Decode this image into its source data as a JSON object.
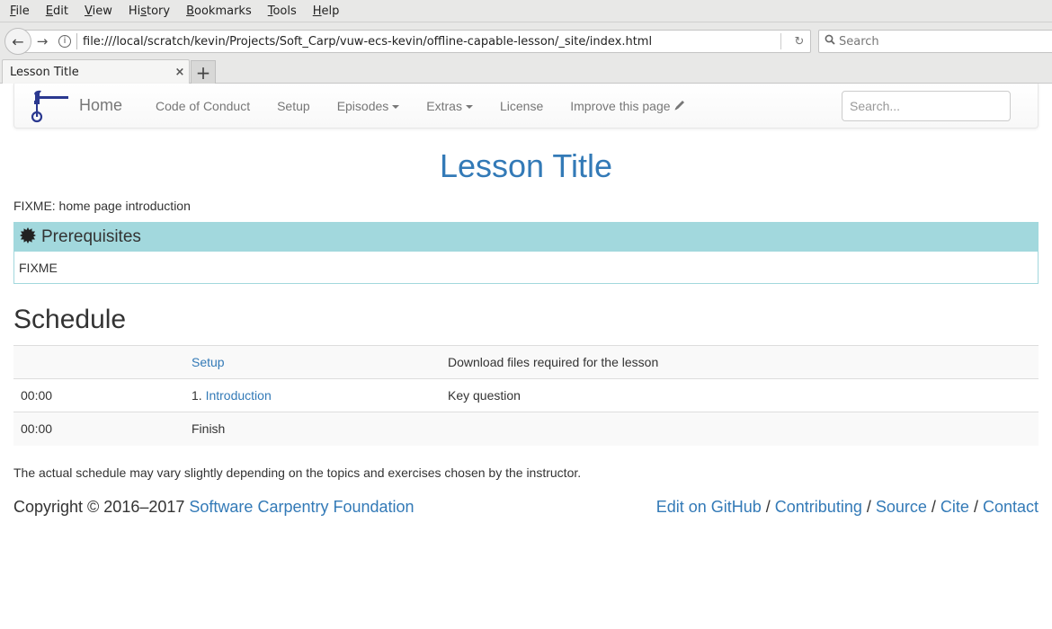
{
  "browser": {
    "menu": [
      {
        "label": "File",
        "accel": "F",
        "rest": "ile",
        "pre": ""
      },
      {
        "label": "Edit",
        "accel": "E",
        "rest": "dit",
        "pre": ""
      },
      {
        "label": "View",
        "accel": "V",
        "rest": "iew",
        "pre": ""
      },
      {
        "label": "History",
        "pre": "Hi",
        "accel": "s",
        "rest": "tory"
      },
      {
        "label": "Bookmarks",
        "accel": "B",
        "rest": "ookmarks",
        "pre": ""
      },
      {
        "label": "Tools",
        "accel": "T",
        "rest": "ools",
        "pre": ""
      },
      {
        "label": "Help",
        "accel": "H",
        "rest": "elp",
        "pre": ""
      }
    ],
    "url": "file:///local/scratch/kevin/Projects/Soft_Carp/vuw-ecs-kevin/offline-capable-lesson/_site/index.html",
    "search_placeholder": "Search",
    "tab_title": "Lesson Title",
    "tab_close": "×",
    "new_tab": "+",
    "icons": {
      "back": "←",
      "forward": "→",
      "info": "i",
      "reload": "↻",
      "search": "🔍"
    }
  },
  "nav": {
    "brand": "Home",
    "links": {
      "conduct": "Code of Conduct",
      "setup": "Setup",
      "episodes": "Episodes",
      "extras": "Extras",
      "license": "License",
      "improve": "Improve this page"
    },
    "pencil": "✎",
    "search_placeholder": "Search...",
    "logo_color": "#2b3990"
  },
  "main": {
    "title": "Lesson Title",
    "intro": "FIXME: home page introduction",
    "prereq": {
      "icon": "✹",
      "heading": "Prerequisites",
      "body": "FIXME"
    },
    "schedule_heading": "Schedule",
    "schedule": [
      {
        "time": "",
        "prefix": "",
        "link": "Setup",
        "plain": "",
        "desc": "Download files required for the lesson"
      },
      {
        "time": "00:00",
        "prefix": "1. ",
        "link": "Introduction",
        "plain": "",
        "desc": "Key question"
      },
      {
        "time": "00:00",
        "prefix": "",
        "link": "",
        "plain": "Finish",
        "desc": ""
      }
    ],
    "note": "The actual schedule may vary slightly depending on the topics and exercises chosen by the instructor."
  },
  "footer": {
    "copyright": "Copyright © 2016–2017 ",
    "foundation": "Software Carpentry Foundation",
    "links": [
      "Edit on GitHub",
      "Contributing",
      "Source",
      "Cite",
      "Contact"
    ],
    "separator": " / "
  },
  "colors": {
    "link": "#337ab7",
    "prereq": "#a2d8dd"
  }
}
